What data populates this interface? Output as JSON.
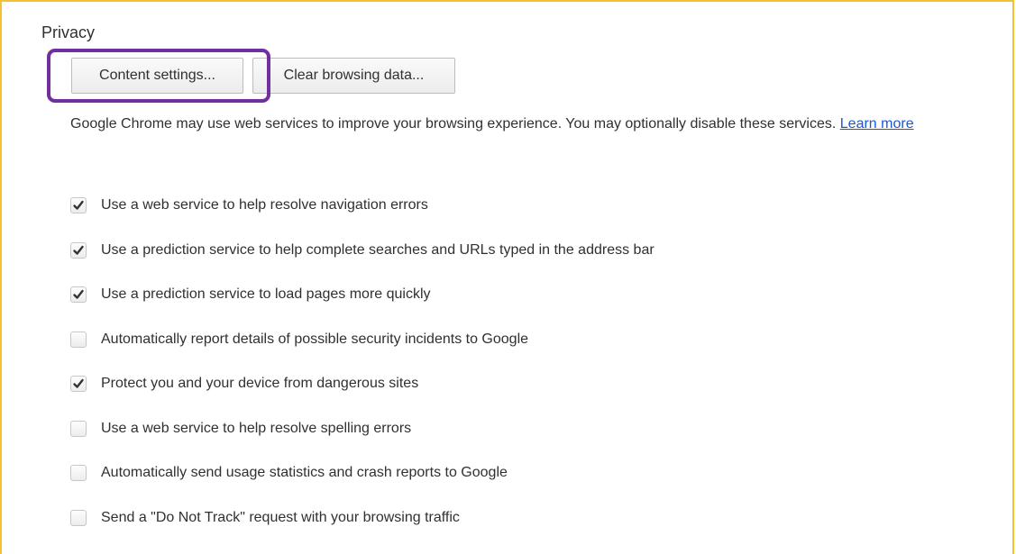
{
  "section_title": "Privacy",
  "buttons": {
    "content_settings": "Content settings...",
    "clear_browsing_data": "Clear browsing data..."
  },
  "description": {
    "text": "Google Chrome may use web services to improve your browsing experience. You may optionally disable these services. ",
    "link": "Learn more"
  },
  "options": [
    {
      "label": "Use a web service to help resolve navigation errors",
      "checked": true
    },
    {
      "label": "Use a prediction service to help complete searches and URLs typed in the address bar",
      "checked": true
    },
    {
      "label": "Use a prediction service to load pages more quickly",
      "checked": true
    },
    {
      "label": "Automatically report details of possible security incidents to Google",
      "checked": false
    },
    {
      "label": "Protect you and your device from dangerous sites",
      "checked": true
    },
    {
      "label": "Use a web service to help resolve spelling errors",
      "checked": false
    },
    {
      "label": "Automatically send usage statistics and crash reports to Google",
      "checked": false
    },
    {
      "label": "Send a \"Do Not Track\" request with your browsing traffic",
      "checked": false
    }
  ],
  "colors": {
    "frame_border": "#f2c230",
    "highlight": "#7030a0",
    "link": "#1a57d6"
  }
}
